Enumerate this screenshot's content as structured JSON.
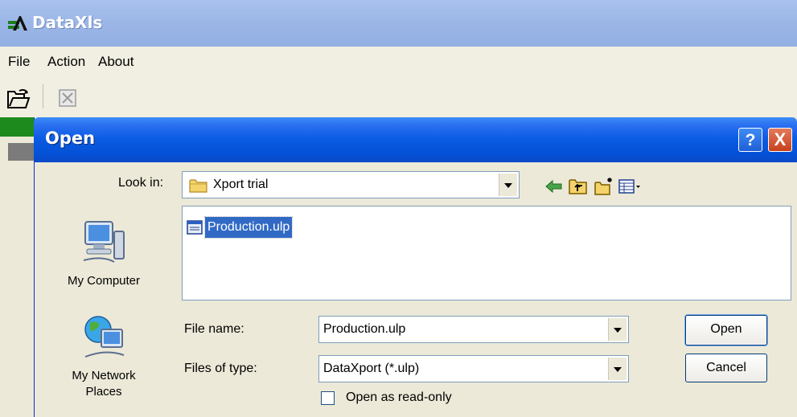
{
  "app": {
    "title": "DataXls",
    "menu": [
      "File",
      "Action",
      "About"
    ]
  },
  "dialog": {
    "title": "Open",
    "look_in_label": "Look in:",
    "look_in_value": "Xport trial",
    "places": [
      "My Computer",
      "My Network\nPlaces"
    ],
    "files": [
      "Production.ulp"
    ],
    "file_name_label": "File name:",
    "file_name_value": "Production.ulp",
    "file_type_label": "Files of type:",
    "file_type_value": "DataXport (*.ulp)",
    "read_only_label": "Open as read-only",
    "read_only_checked": false,
    "open_button": "Open",
    "cancel_button": "Cancel",
    "help_button": "?",
    "close_button": "X"
  },
  "colors": {
    "title_bar": "#0a5ae3",
    "selection": "#316ac5",
    "dialog_bg": "#ece9d8"
  },
  "icons": [
    "folder-icon",
    "back-arrow-icon",
    "up-folder-icon",
    "new-folder-icon",
    "view-menu-icon",
    "my-computer-icon",
    "my-network-icon",
    "file-icon",
    "open-folder-icon",
    "export-icon"
  ]
}
